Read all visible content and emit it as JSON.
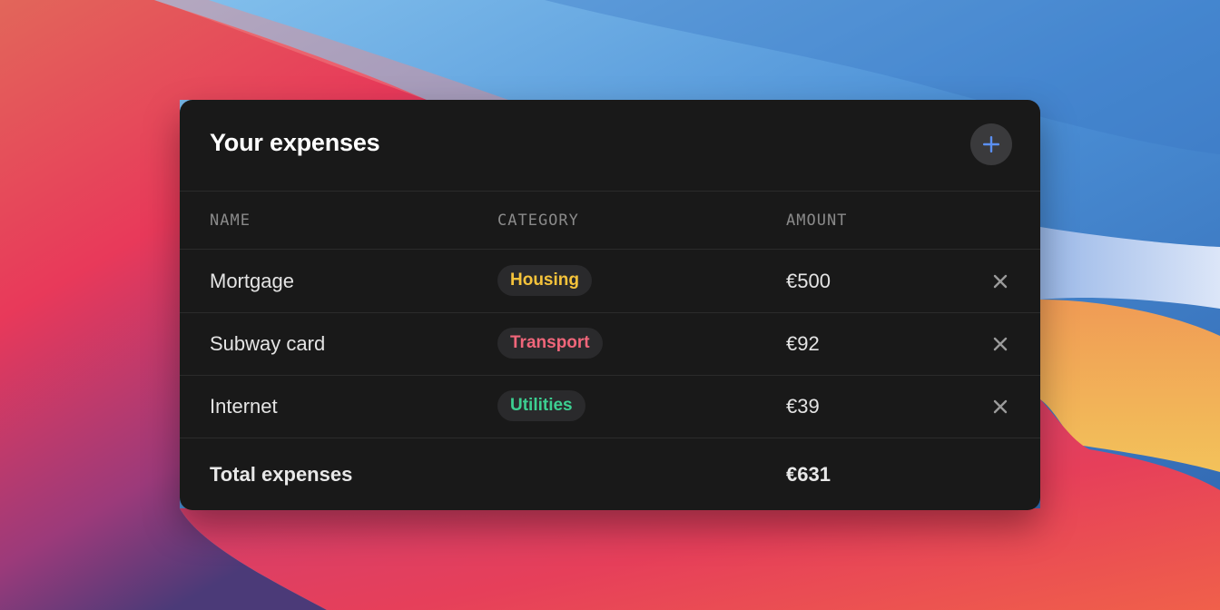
{
  "colors": {
    "card_bg": "#191919",
    "accent_plus": "#5b8ff0",
    "housing": "#f5c33b",
    "transport": "#f0667a",
    "utilities": "#3ccf91",
    "muted": "#8a8a8a"
  },
  "header": {
    "title": "Your expenses",
    "add_icon": "plus-icon"
  },
  "columns": {
    "name": "NAME",
    "category": "CATEGORY",
    "amount": "AMOUNT"
  },
  "rows": [
    {
      "name": "Mortgage",
      "category": "Housing",
      "category_color": "#f5c33b",
      "amount": "€500",
      "remove_icon": "close-icon"
    },
    {
      "name": "Subway card",
      "category": "Transport",
      "category_color": "#f0667a",
      "amount": "€92",
      "remove_icon": "close-icon"
    },
    {
      "name": "Internet",
      "category": "Utilities",
      "category_color": "#3ccf91",
      "amount": "€39",
      "remove_icon": "close-icon"
    }
  ],
  "total": {
    "label": "Total expenses",
    "amount": "€631"
  }
}
